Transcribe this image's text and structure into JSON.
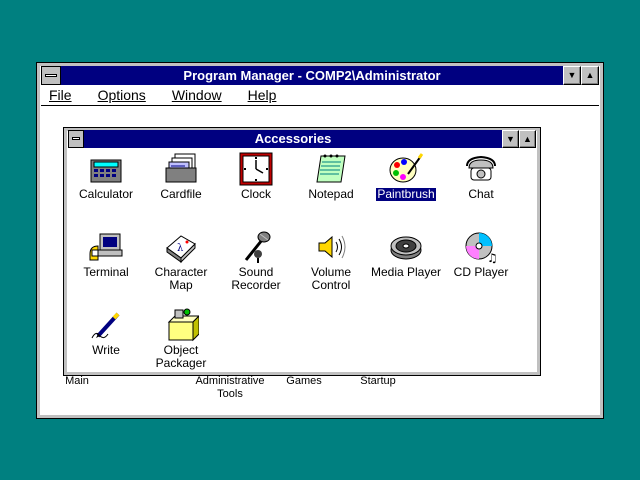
{
  "program_manager": {
    "title": "Program Manager - COMP2\\Administrator",
    "menu": [
      "File",
      "Options",
      "Window",
      "Help"
    ]
  },
  "accessories": {
    "title": "Accessories",
    "items": [
      {
        "label": "Calculator",
        "icon": "calculator-icon"
      },
      {
        "label": "Cardfile",
        "icon": "cardfile-icon"
      },
      {
        "label": "Clock",
        "icon": "clock-icon"
      },
      {
        "label": "Notepad",
        "icon": "notepad-icon"
      },
      {
        "label": "Paintbrush",
        "icon": "paintbrush-icon",
        "selected": true
      },
      {
        "label": "Chat",
        "icon": "chat-icon"
      },
      {
        "label": "Terminal",
        "icon": "terminal-icon"
      },
      {
        "label": "Character Map",
        "icon": "character-map-icon"
      },
      {
        "label": "Sound Recorder",
        "icon": "sound-recorder-icon"
      },
      {
        "label": "Volume Control",
        "icon": "volume-control-icon"
      },
      {
        "label": "Media Player",
        "icon": "media-player-icon"
      },
      {
        "label": "CD Player",
        "icon": "cd-player-icon"
      },
      {
        "label": "Write",
        "icon": "write-icon"
      },
      {
        "label": "Object Packager",
        "icon": "object-packager-icon"
      }
    ]
  },
  "groups": [
    {
      "label": "Main"
    },
    {
      "label": "Administrative Tools"
    },
    {
      "label": "Games"
    },
    {
      "label": "Startup"
    }
  ],
  "colors": {
    "desktop": "#008080",
    "titlebar": "#000080",
    "selection": "#000080"
  }
}
